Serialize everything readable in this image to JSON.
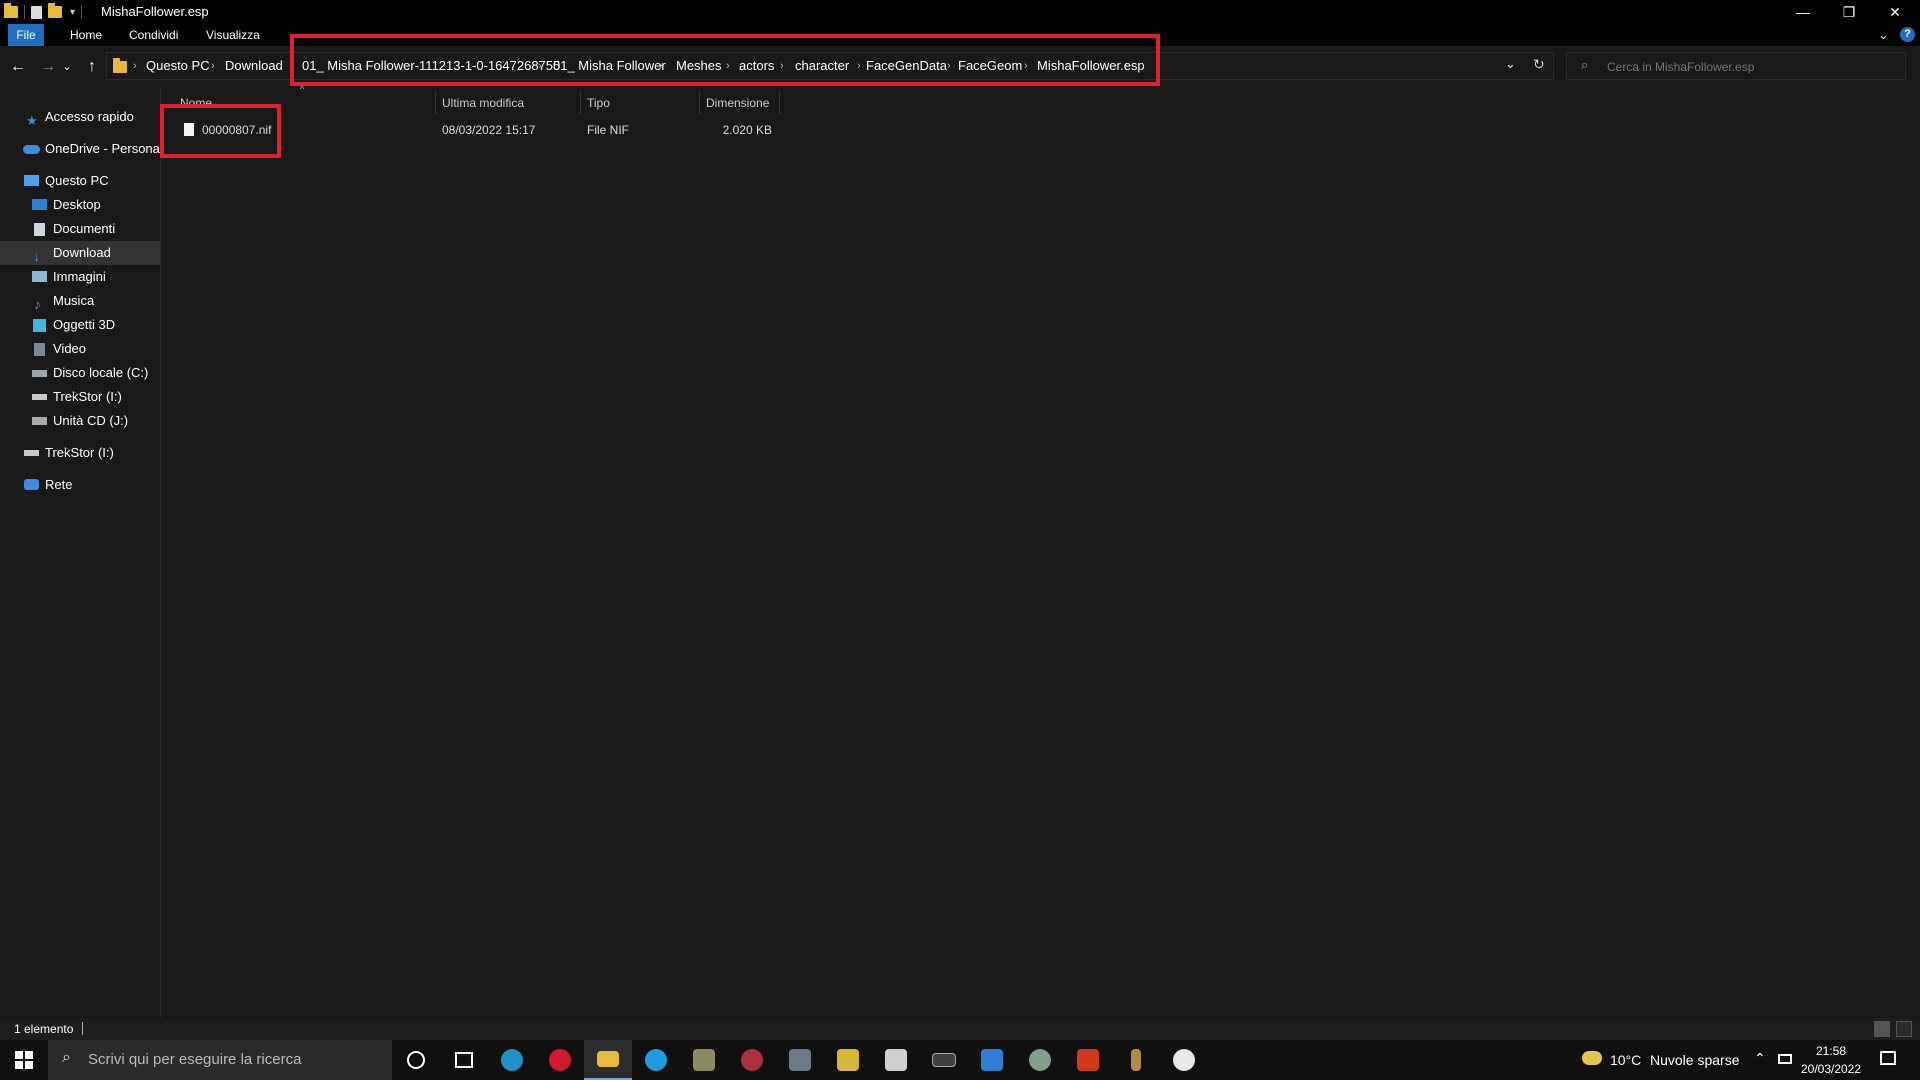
{
  "window": {
    "title": "MishaFollower.esp"
  },
  "ribbon": {
    "tabs": [
      "File",
      "Home",
      "Condividi",
      "Visualizza"
    ]
  },
  "address": {
    "root_crumbs": [
      "Questo PC",
      "Download"
    ],
    "highlighted_crumbs": [
      "01_ Misha Follower-111213-1-0-1647268755",
      "01_ Misha Follower",
      "Meshes",
      "actors",
      "character",
      "FaceGenData",
      "FaceGeom",
      "MishaFollower.esp"
    ]
  },
  "search": {
    "placeholder": "Cerca in MishaFollower.esp"
  },
  "sidebar": {
    "items": [
      {
        "label": "Accesso rapido",
        "icon": "star-icon"
      },
      {
        "label": "OneDrive - Personal",
        "icon": "cloud-icon"
      },
      {
        "label": "Questo PC",
        "icon": "computer-icon"
      },
      {
        "label": "Desktop",
        "icon": "desktop-icon"
      },
      {
        "label": "Documenti",
        "icon": "document-icon"
      },
      {
        "label": "Download",
        "icon": "download-icon",
        "selected": true
      },
      {
        "label": "Immagini",
        "icon": "image-icon"
      },
      {
        "label": "Musica",
        "icon": "music-icon"
      },
      {
        "label": "Oggetti 3D",
        "icon": "cube-icon"
      },
      {
        "label": "Video",
        "icon": "video-icon"
      },
      {
        "label": "Disco locale (C:)",
        "icon": "drive-icon"
      },
      {
        "label": "TrekStor (I:)",
        "icon": "usb-drive-icon"
      },
      {
        "label": "Unità CD (J:)",
        "icon": "cd-drive-icon"
      },
      {
        "label": "TrekStor (I:)",
        "icon": "usb-drive-icon"
      },
      {
        "label": "Rete",
        "icon": "network-icon"
      }
    ]
  },
  "columns": [
    "Nome",
    "Ultima modifica",
    "Tipo",
    "Dimensione"
  ],
  "files": [
    {
      "name": "00000807.nif",
      "modified": "08/03/2022 15:17",
      "type": "File NIF",
      "size": "2.020 KB"
    }
  ],
  "status": {
    "count": "1 elemento"
  },
  "taskbar": {
    "search_placeholder": "Scrivi qui per eseguire la ricerca",
    "weather": {
      "temp": "10°C",
      "desc": "Nuvole sparse"
    },
    "time": "21:58",
    "date": "20/03/2022"
  },
  "colors": {
    "accent": "#1e6fbf",
    "highlight_box": "#e0202a",
    "folder": "#e8b93a"
  }
}
